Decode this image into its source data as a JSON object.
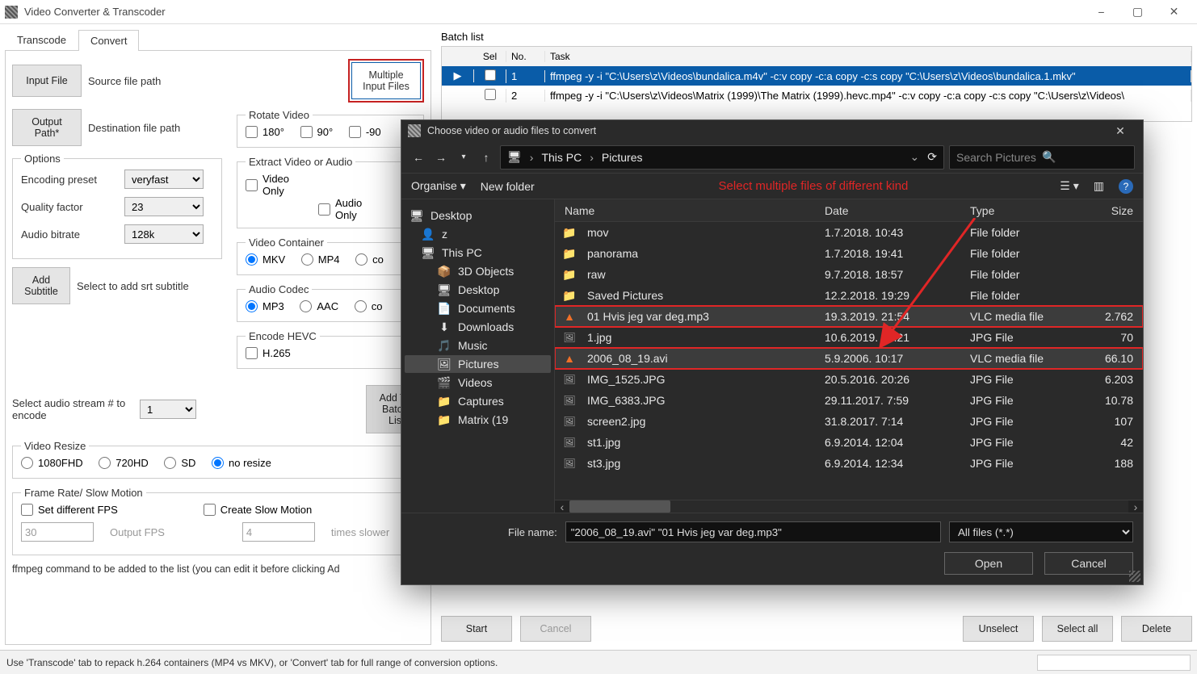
{
  "window": {
    "title": "Video Converter & Transcoder",
    "min_label": "−",
    "max_label": "▢",
    "close_label": "✕"
  },
  "tabs": {
    "transcode": "Transcode",
    "convert": "Convert"
  },
  "convert": {
    "input_file_btn": "Input File",
    "source_label": "Source file path",
    "multiple_btn": "Multiple\nInput Files",
    "output_path_btn": "Output\nPath*",
    "dest_label": "Destination file path",
    "rotate_legend": "Rotate Video",
    "rotate_180": "180°",
    "rotate_90p": "90°",
    "rotate_90n": "-90",
    "extract_legend": "Extract Video or Audio",
    "video_only": "Video\nOnly",
    "audio_only": "Audio\nOnly",
    "options_legend": "Options",
    "enc_preset_label": "Encoding preset",
    "enc_preset_value": "veryfast",
    "quality_label": "Quality factor",
    "quality_value": "23",
    "audiobr_label": "Audio bitrate",
    "audiobr_value": "128k",
    "addsub_btn": "Add\nSubtitle",
    "addsub_hint": "Select to add srt subtitle",
    "container_legend": "Video Container",
    "container_mkv": "MKV",
    "container_mp4": "MP4",
    "container_co": "co",
    "audiocodec_legend": "Audio Codec",
    "ac_mp3": "MP3",
    "ac_aac": "AAC",
    "ac_co": "co",
    "hevc_legend": "Encode HEVC",
    "hevc_check": "H.265",
    "audiostream_label": "Select audio stream # to encode",
    "audiostream_value": "1",
    "addto_btn": "Add To\nBatch Lis",
    "resize_legend": "Video Resize",
    "resize_1080": "1080FHD",
    "resize_720": "720HD",
    "resize_sd": "SD",
    "resize_none": "no resize",
    "fps_legend": "Frame Rate/ Slow Motion",
    "fps_set": "Set different FPS",
    "fps_create": "Create Slow Motion",
    "fps_out_value": "30",
    "fps_out_hint": "Output FPS",
    "fps_slow_value": "4",
    "fps_slow_hint": "times slower",
    "cmd_hint": "ffmpeg command to be added to the list (you can edit it before clicking Ad"
  },
  "status": {
    "text": "Use 'Transcode' tab to repack h.264 containers (MP4 vs MKV), or 'Convert' tab for full range of conversion options."
  },
  "batch": {
    "title": "Batch list",
    "head_sel": "Sel",
    "head_no": "No.",
    "head_task": "Task",
    "rows": [
      {
        "no": "1",
        "task": "ffmpeg -y -i \"C:\\Users\\z\\Videos\\bundalica.m4v\" -c:v copy -c:a copy -c:s copy \"C:\\Users\\z\\Videos\\bundalica.1.mkv\""
      },
      {
        "no": "2",
        "task": "ffmpeg -y -i \"C:\\Users\\z\\Videos\\Matrix (1999)\\The Matrix (1999).hevc.mp4\" -c:v copy -c:a copy -c:s copy \"C:\\Users\\z\\Videos\\"
      }
    ],
    "start_btn": "Start",
    "cancel_btn": "Cancel",
    "unselect_btn": "Unselect",
    "selectall_btn": "Select all",
    "delete_btn": "Delete"
  },
  "dialog": {
    "title": "Choose video or audio files to convert",
    "crumb_thispc": "This PC",
    "crumb_pictures": "Pictures",
    "search_placeholder": "Search Pictures",
    "organise": "Organise",
    "newfolder": "New folder",
    "annotation": "Select multiple files of different kind",
    "tree": [
      {
        "label": "Desktop",
        "icon": "🖥",
        "indent": 0
      },
      {
        "label": "z",
        "icon": "👤",
        "indent": 1
      },
      {
        "label": "This PC",
        "icon": "🖥",
        "indent": 1
      },
      {
        "label": "3D Objects",
        "icon": "📦",
        "indent": 2
      },
      {
        "label": "Desktop",
        "icon": "🖥",
        "indent": 2
      },
      {
        "label": "Documents",
        "icon": "📄",
        "indent": 2
      },
      {
        "label": "Downloads",
        "icon": "⬇",
        "indent": 2
      },
      {
        "label": "Music",
        "icon": "🎵",
        "indent": 2
      },
      {
        "label": "Pictures",
        "icon": "🖼",
        "indent": 2,
        "selected": true
      },
      {
        "label": "Videos",
        "icon": "🎬",
        "indent": 2
      },
      {
        "label": "Captures",
        "icon": "📁",
        "indent": 2
      },
      {
        "label": "Matrix (19",
        "icon": "📁",
        "indent": 2
      }
    ],
    "head_name": "Name",
    "head_date": "Date",
    "head_type": "Type",
    "head_size": "Size",
    "rows": [
      {
        "name": "mov",
        "date": "1.7.2018. 10:43",
        "type": "File folder",
        "size": "",
        "icon": "folder"
      },
      {
        "name": "panorama",
        "date": "1.7.2018. 19:41",
        "type": "File folder",
        "size": "",
        "icon": "folder"
      },
      {
        "name": "raw",
        "date": "9.7.2018. 18:57",
        "type": "File folder",
        "size": "",
        "icon": "folder"
      },
      {
        "name": "Saved Pictures",
        "date": "12.2.2018. 19:29",
        "type": "File folder",
        "size": "",
        "icon": "folder"
      },
      {
        "name": "01 Hvis jeg var deg.mp3",
        "date": "19.3.2019. 21:54",
        "type": "VLC media file",
        "size": "2.762",
        "icon": "vlc",
        "selected": true,
        "redbox": true
      },
      {
        "name": "1.jpg",
        "date": "10.6.2019. 18:21",
        "type": "JPG File",
        "size": "70",
        "icon": "img"
      },
      {
        "name": "2006_08_19.avi",
        "date": "5.9.2006. 10:17",
        "type": "VLC media file",
        "size": "66.10",
        "icon": "vlc",
        "selected": true,
        "redbox": true
      },
      {
        "name": "IMG_1525.JPG",
        "date": "20.5.2016. 20:26",
        "type": "JPG File",
        "size": "6.203",
        "icon": "img"
      },
      {
        "name": "IMG_6383.JPG",
        "date": "29.11.2017. 7:59",
        "type": "JPG File",
        "size": "10.78",
        "icon": "img"
      },
      {
        "name": "screen2.jpg",
        "date": "31.8.2017. 7:14",
        "type": "JPG File",
        "size": "107",
        "icon": "img"
      },
      {
        "name": "st1.jpg",
        "date": "6.9.2014. 12:04",
        "type": "JPG File",
        "size": "42",
        "icon": "img"
      },
      {
        "name": "st3.jpg",
        "date": "6.9.2014. 12:34",
        "type": "JPG File",
        "size": "188",
        "icon": "img"
      }
    ],
    "file_name_label": "File name:",
    "file_name_value": "\"2006_08_19.avi\" \"01 Hvis jeg var deg.mp3\"",
    "filter_value": "All files (*.*)",
    "open_btn": "Open",
    "cancel_btn": "Cancel"
  }
}
